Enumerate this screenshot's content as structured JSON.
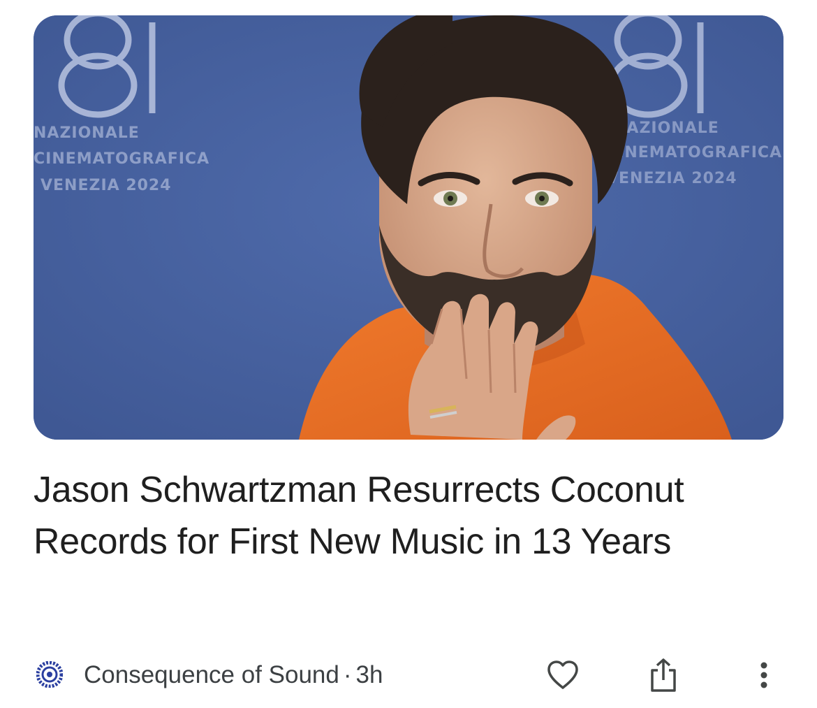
{
  "article": {
    "image_alt": "Jason Schwartzman in an orange shirt at the Venice Film Festival photocall",
    "backdrop_text": {
      "number": "81",
      "line1": "NAZIONALE",
      "line2": "CINEMATOGRAFICA",
      "line3": "VENEZIA 2024"
    },
    "headline": "Jason Schwartzman Resurrects Coconut Records for First New Music in 13 Years",
    "source": "Consequence of Sound",
    "separator": "·",
    "age": "3h"
  },
  "actions": {
    "like_icon": "heart-outline-icon",
    "share_icon": "share-icon",
    "more_icon": "more-vertical-icon"
  },
  "colors": {
    "backdrop": "#45609f",
    "shirt": "#e8702a",
    "text": "#1f1f1f",
    "meta_text": "#3c4043",
    "icon": "#444746",
    "source_logo": "#2b3fa0"
  }
}
